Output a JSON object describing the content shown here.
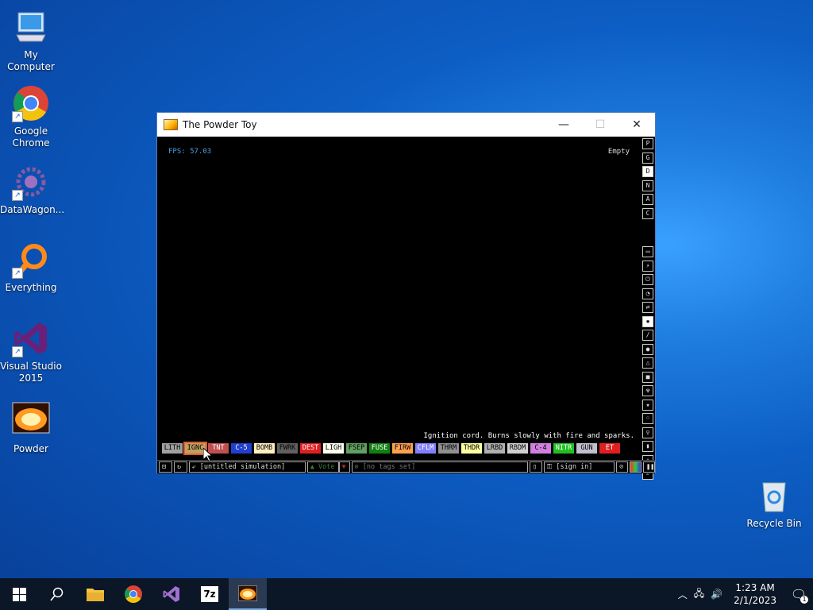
{
  "desktop": {
    "icons": [
      {
        "label": "My Computer",
        "icon": "computer-icon"
      },
      {
        "label": "Google Chrome",
        "icon": "chrome-icon"
      },
      {
        "label": "DataWagon...",
        "icon": "datawagon-icon"
      },
      {
        "label": "Everything",
        "icon": "everything-icon"
      },
      {
        "label": "Visual Studio 2015",
        "icon": "visual-studio-icon"
      },
      {
        "label": "Powder",
        "icon": "powder-icon"
      },
      {
        "label": "Recycle Bin",
        "icon": "recycle-bin-icon"
      }
    ]
  },
  "window": {
    "title": "The Powder Toy",
    "fps": "FPS: 57.03",
    "hover_info": "Empty",
    "element_description": "Ignition cord. Burns slowly with fire and sparks.",
    "top_menu": [
      "P",
      "G",
      "D",
      "N",
      "A",
      "C"
    ],
    "selected_menu": "D",
    "elements": [
      {
        "name": "LITH",
        "color": "#a0a0a0",
        "dark": true
      },
      {
        "name": "IGNC",
        "color": "#c0a060",
        "dark": true,
        "selected": true
      },
      {
        "name": "TNT",
        "color": "#c05050",
        "dark": false
      },
      {
        "name": "C-5",
        "color": "#2040d0",
        "dark": false
      },
      {
        "name": "BOMB",
        "color": "#fff0c0",
        "dark": true
      },
      {
        "name": "FWRK",
        "color": "#606060",
        "dark": true
      },
      {
        "name": "DEST",
        "color": "#e02020",
        "dark": false
      },
      {
        "name": "LIGH",
        "color": "#fffff0",
        "dark": true
      },
      {
        "name": "FSEP",
        "color": "#60a060",
        "dark": true
      },
      {
        "name": "FUSE",
        "color": "#108010",
        "dark": false
      },
      {
        "name": "FIRW",
        "color": "#ffa050",
        "dark": true
      },
      {
        "name": "CFLM",
        "color": "#8080ff",
        "dark": false
      },
      {
        "name": "THRM",
        "color": "#909090",
        "dark": true
      },
      {
        "name": "THDR",
        "color": "#ffffa0",
        "dark": true
      },
      {
        "name": "LRBD",
        "color": "#b0b0b0",
        "dark": true
      },
      {
        "name": "RBDM",
        "color": "#d0d0d0",
        "dark": true
      },
      {
        "name": "C-4",
        "color": "#d080e0",
        "dark": true
      },
      {
        "name": "NITR",
        "color": "#20c020",
        "dark": false
      },
      {
        "name": "GUN",
        "color": "#c0c0d0",
        "dark": true
      },
      {
        "name": "ET",
        "color": "#e02020",
        "dark": false
      }
    ],
    "bottom": {
      "sim_name": "[untitled simulation]",
      "vote": "Vote",
      "tags": "[no tags set]",
      "sign_in": "[sign in]"
    }
  },
  "taskbar": {
    "time": "1:23 AM",
    "date": "2/1/2023",
    "notification_count": "1"
  }
}
